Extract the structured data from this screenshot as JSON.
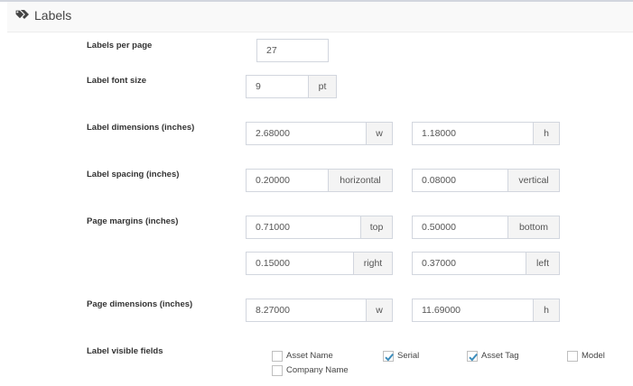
{
  "header": {
    "title": "Labels"
  },
  "fields": {
    "per_page": {
      "label": "Labels per page",
      "value": "27"
    },
    "font_size": {
      "label": "Label font size",
      "value": "9",
      "unit": "pt"
    },
    "dimensions": {
      "label": "Label dimensions (inches)",
      "width": "2.68000",
      "width_unit": "w",
      "height": "1.18000",
      "height_unit": "h"
    },
    "spacing": {
      "label": "Label spacing (inches)",
      "horizontal": "0.20000",
      "horizontal_unit": "horizontal",
      "vertical": "0.08000",
      "vertical_unit": "vertical"
    },
    "margins": {
      "label": "Page margins (inches)",
      "top": "0.71000",
      "top_unit": "top",
      "bottom": "0.50000",
      "bottom_unit": "bottom",
      "right": "0.15000",
      "right_unit": "right",
      "left": "0.37000",
      "left_unit": "left"
    },
    "page": {
      "label": "Page dimensions (inches)",
      "width": "8.27000",
      "width_unit": "w",
      "height": "11.69000",
      "height_unit": "h"
    }
  },
  "visible_fields": {
    "label": "Label visible fields",
    "options": [
      {
        "label": "Asset Name",
        "checked": false
      },
      {
        "label": "Serial",
        "checked": true
      },
      {
        "label": "Asset Tag",
        "checked": true
      },
      {
        "label": "Model",
        "checked": false
      },
      {
        "label": "Company Name",
        "checked": false
      }
    ]
  },
  "colors": {
    "check": "#3c8dbc",
    "border": "#d2d6de",
    "addon_bg": "#f4f4f4"
  }
}
